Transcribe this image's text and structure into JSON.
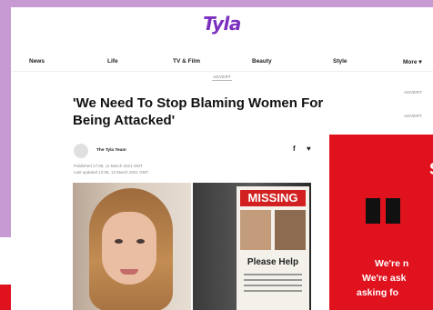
{
  "site": {
    "logo": "Tyla"
  },
  "nav": {
    "items": [
      {
        "label": "News"
      },
      {
        "label": "Life"
      },
      {
        "label": "TV & Film"
      },
      {
        "label": "Beauty"
      },
      {
        "label": "Style"
      },
      {
        "label": "More"
      }
    ]
  },
  "ads": {
    "top_label": "ADVERT",
    "side_label_1": "ADVERT",
    "side_label_2": "ADVERT"
  },
  "article": {
    "headline": "'We Need To Stop Blaming Women For Being Attacked'",
    "author": "The Tyla Team",
    "published": "Published 17:08, 11 March 2021 GMT",
    "updated": "Last updated 12:08, 12 March 2021 GMT"
  },
  "poster": {
    "title": "MISSING",
    "subtitle": "Please Help"
  },
  "promo": {
    "letter": "S",
    "line1": "We're n",
    "line2": "We're ask",
    "line3": "asking fo"
  },
  "colors": {
    "background": "#c79ad3",
    "brand": "#7b2fbf",
    "promo_red": "#e0121e"
  }
}
